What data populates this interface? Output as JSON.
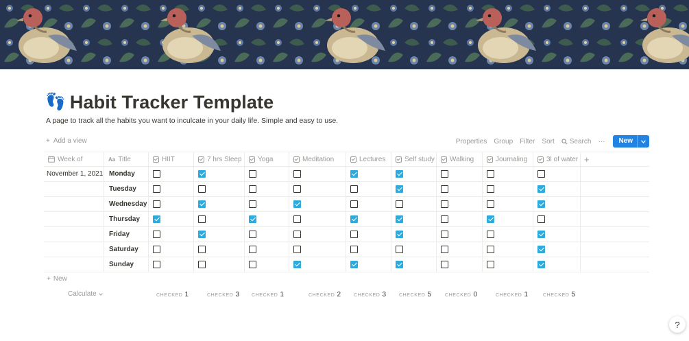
{
  "page": {
    "icon": "👣",
    "title": "Habit Tracker Template",
    "description": "A page to track all the habits you want to inculcate in your daily life. Simple and easy to use."
  },
  "toolbar": {
    "add_view": "Add a view",
    "properties": "Properties",
    "group": "Group",
    "filter": "Filter",
    "sort": "Sort",
    "search": "Search",
    "more": "···",
    "new": "New"
  },
  "table": {
    "columns": {
      "week": "Week of",
      "title": "Title",
      "habits": [
        "HIIT",
        "7 hrs Sleep",
        "Yoga",
        "Meditation",
        "Lectures",
        "Self study",
        "Walking",
        "Journaling",
        "3l of water"
      ]
    },
    "rows": [
      {
        "week": "November 1, 2021",
        "title": "Monday",
        "checks": [
          false,
          true,
          false,
          false,
          true,
          true,
          false,
          false,
          false
        ]
      },
      {
        "week": "",
        "title": "Tuesday",
        "checks": [
          false,
          false,
          false,
          false,
          false,
          true,
          false,
          false,
          true
        ]
      },
      {
        "week": "",
        "title": "Wednesday",
        "checks": [
          false,
          true,
          false,
          true,
          false,
          false,
          false,
          false,
          true
        ]
      },
      {
        "week": "",
        "title": "Thursday",
        "checks": [
          true,
          false,
          true,
          false,
          true,
          true,
          false,
          true,
          false
        ]
      },
      {
        "week": "",
        "title": "Friday",
        "checks": [
          false,
          true,
          false,
          false,
          false,
          true,
          false,
          false,
          true
        ]
      },
      {
        "week": "",
        "title": "Saturday",
        "checks": [
          false,
          false,
          false,
          false,
          false,
          false,
          false,
          false,
          true
        ]
      },
      {
        "week": "",
        "title": "Sunday",
        "checks": [
          false,
          false,
          false,
          true,
          true,
          true,
          false,
          false,
          true
        ]
      }
    ],
    "new_row": "New",
    "calculate": "Calculate",
    "checked_label": "CHECKED",
    "checked_counts": [
      "1",
      "3",
      "1",
      "2",
      "3",
      "5",
      "0",
      "1",
      "5"
    ]
  },
  "help": "?",
  "colors": {
    "accent": "#2383e2",
    "checkbox": "#2eaadc",
    "text": "#37352f",
    "muted": "#9b9a97"
  }
}
